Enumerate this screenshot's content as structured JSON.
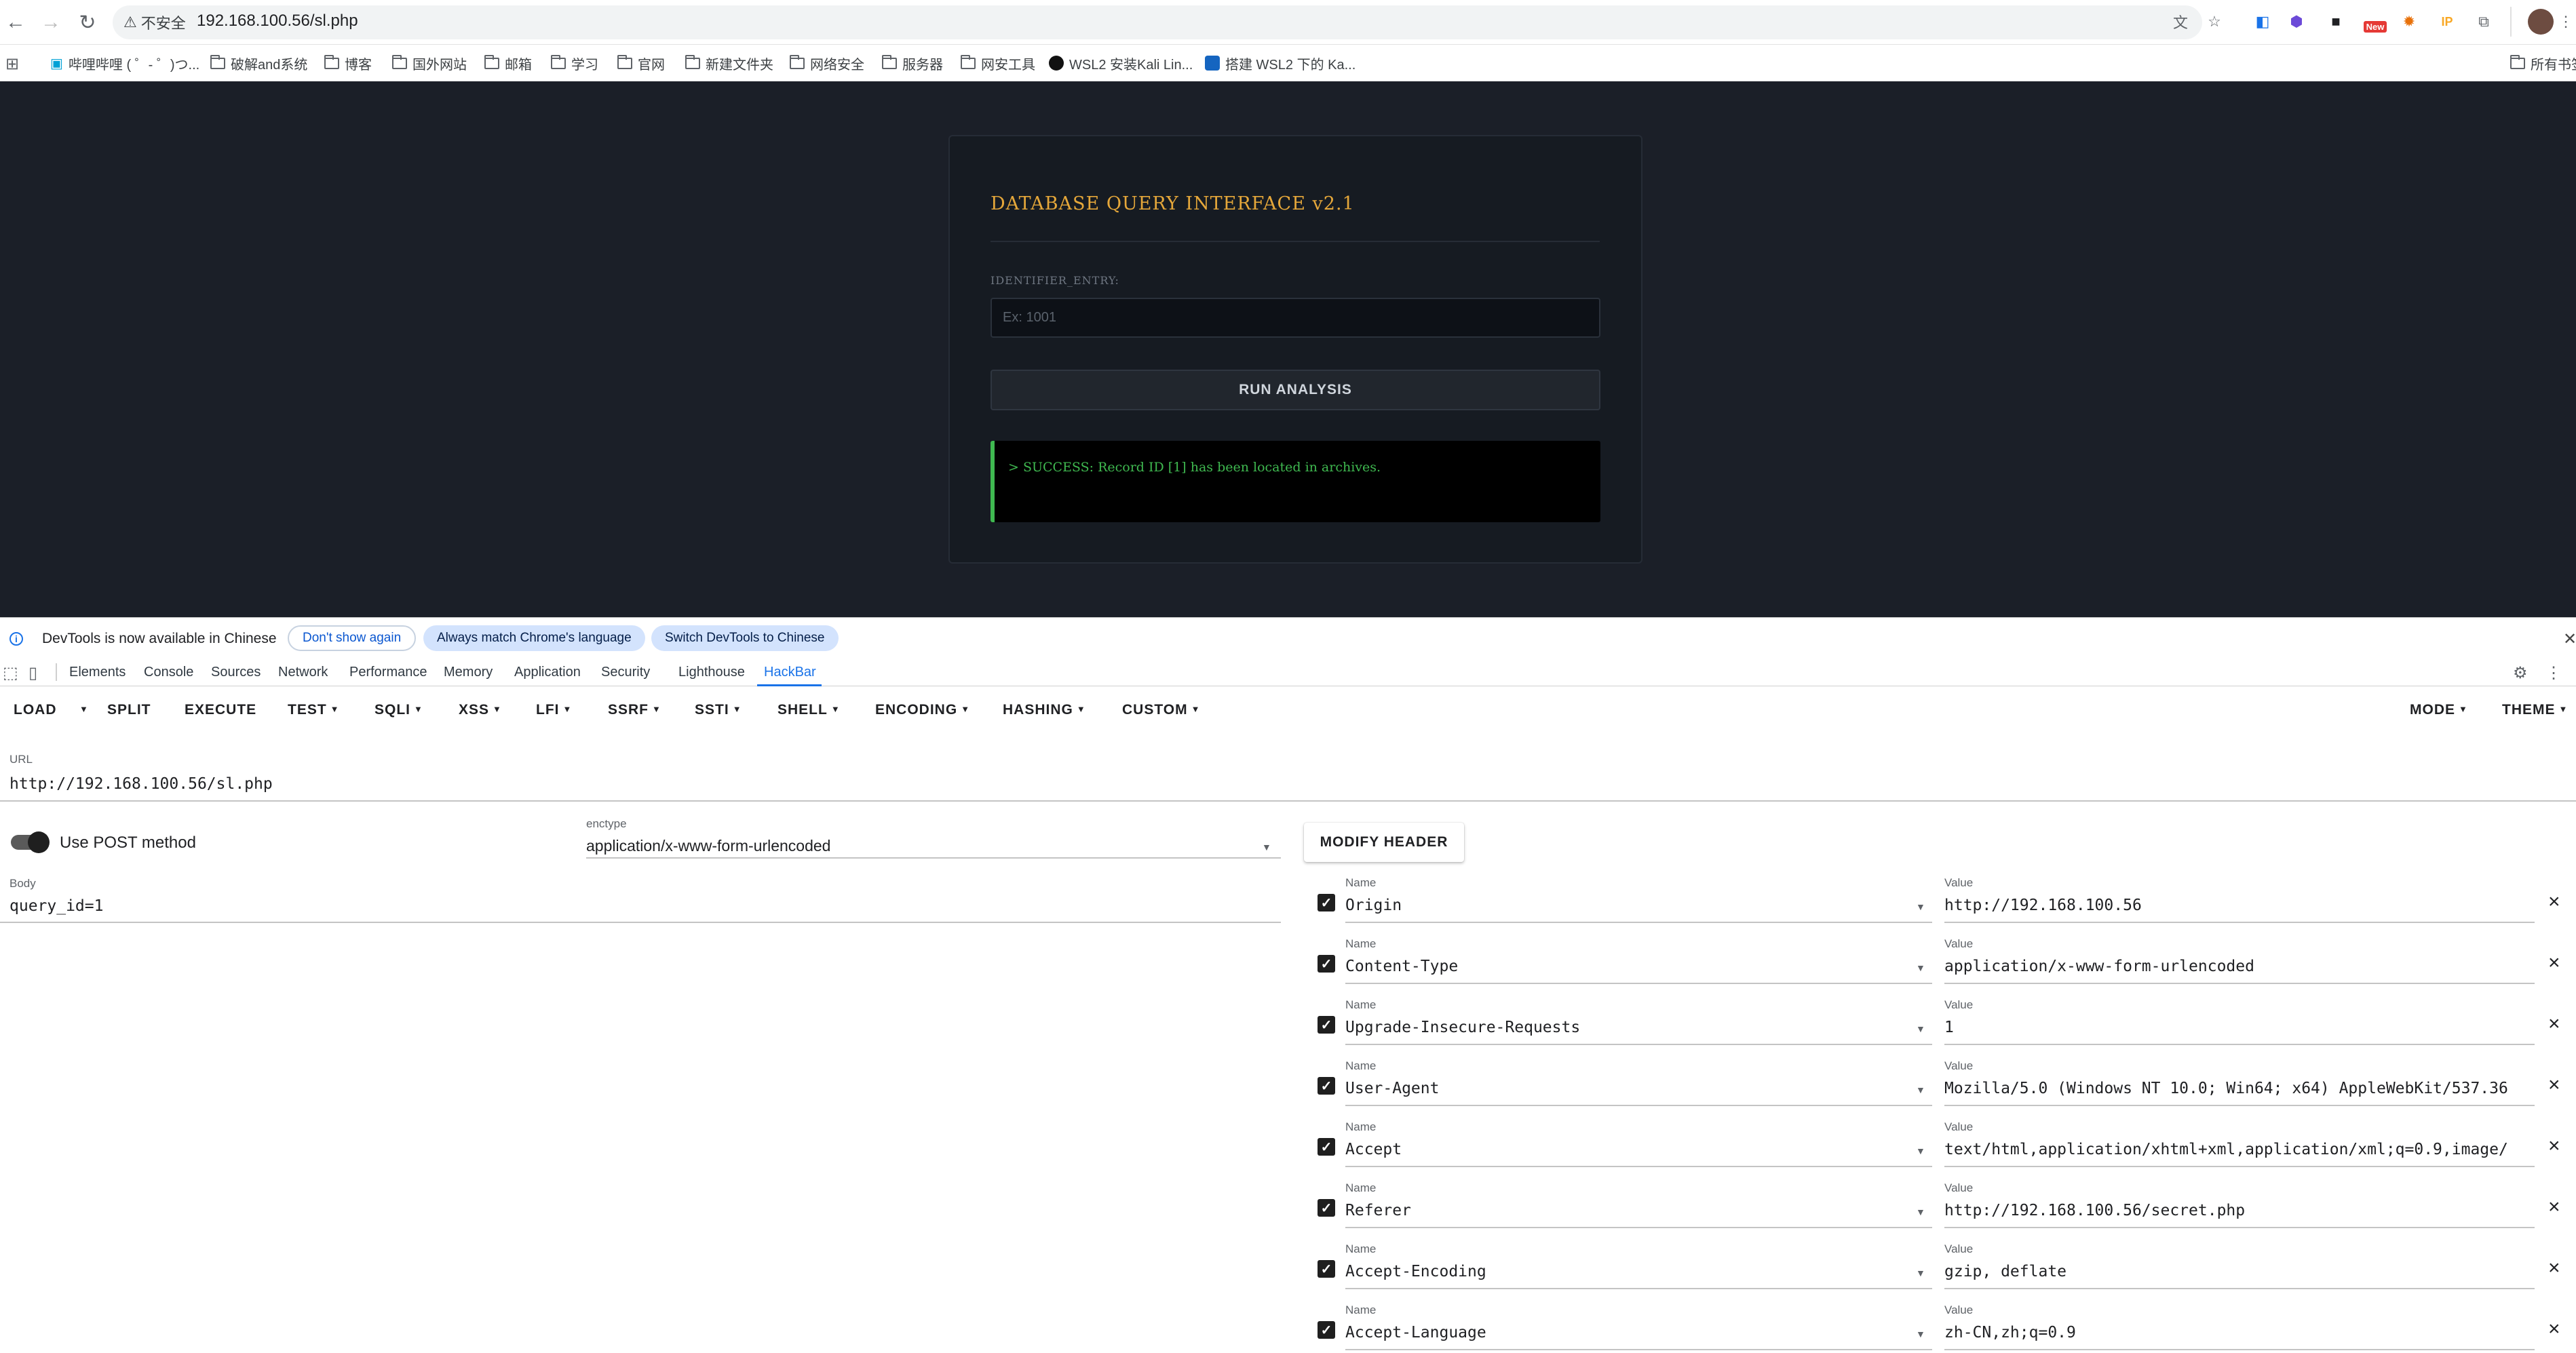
{
  "browser": {
    "security_label": "不安全",
    "url": "192.168.100.56/sl.php",
    "new_badge": "New",
    "ip_badge": "IP"
  },
  "bookmarks": {
    "items": [
      {
        "label": "哔哩哔哩 ( ゜- ゜)つ...",
        "icon": "bilibili-icon"
      },
      {
        "label": "破解and系统",
        "icon": "folder-icon"
      },
      {
        "label": "博客",
        "icon": "folder-icon"
      },
      {
        "label": "国外网站",
        "icon": "folder-icon"
      },
      {
        "label": "邮箱",
        "icon": "folder-icon"
      },
      {
        "label": "学习",
        "icon": "folder-icon"
      },
      {
        "label": "官网",
        "icon": "folder-icon"
      },
      {
        "label": "新建文件夹",
        "icon": "folder-icon"
      },
      {
        "label": "网络安全",
        "icon": "folder-icon"
      },
      {
        "label": "服务器",
        "icon": "folder-icon"
      },
      {
        "label": "网安工具",
        "icon": "folder-icon"
      },
      {
        "label": "WSL2 安装Kali Lin...",
        "icon": "github-icon"
      },
      {
        "label": "搭建 WSL2 下的 Ka...",
        "icon": "site-icon"
      }
    ],
    "all_bookmarks": "所有书签"
  },
  "page": {
    "title": "DATABASE QUERY INTERFACE v2.1",
    "identifier_label": "IDENTIFIER_ENTRY:",
    "identifier_placeholder": "Ex: 1001",
    "run_button": "RUN ANALYSIS",
    "result": "> SUCCESS: Record ID [1] has been located in archives."
  },
  "devtools": {
    "info_text": "DevTools is now available in Chinese",
    "dont_show": "Don't show again",
    "always_match": "Always match Chrome's language",
    "switch_chinese": "Switch DevTools to Chinese",
    "tabs": [
      "Elements",
      "Console",
      "Sources",
      "Network",
      "Performance",
      "Memory",
      "Application",
      "Security",
      "Lighthouse",
      "HackBar"
    ],
    "active_tab": "HackBar"
  },
  "hackbar": {
    "menu": [
      "LOAD",
      "SPLIT",
      "EXECUTE",
      "TEST",
      "SQLI",
      "XSS",
      "LFI",
      "SSRF",
      "SSTI",
      "SHELL",
      "ENCODING",
      "HASHING",
      "CUSTOM"
    ],
    "mode": "MODE",
    "theme": "THEME",
    "url_label": "URL",
    "url_value": "http://192.168.100.56/sl.php",
    "post_method_label": "Use POST method",
    "post_method_enabled": true,
    "enctype_label": "enctype",
    "enctype_value": "application/x-www-form-urlencoded",
    "body_label": "Body",
    "body_value": "query_id=1",
    "modify_header": "MODIFY HEADER",
    "name_label": "Name",
    "value_label": "Value",
    "headers": [
      {
        "name": "Origin",
        "value": "http://192.168.100.56",
        "checked": true
      },
      {
        "name": "Content-Type",
        "value": "application/x-www-form-urlencoded",
        "checked": true
      },
      {
        "name": "Upgrade-Insecure-Requests",
        "value": "1",
        "checked": true
      },
      {
        "name": "User-Agent",
        "value": "Mozilla/5.0 (Windows NT 10.0; Win64; x64) AppleWebKit/537.36",
        "checked": true
      },
      {
        "name": "Accept",
        "value": "text/html,application/xhtml+xml,application/xml;q=0.9,image/",
        "checked": true
      },
      {
        "name": "Referer",
        "value": "http://192.168.100.56/secret.php",
        "checked": true
      },
      {
        "name": "Accept-Encoding",
        "value": "gzip, deflate",
        "checked": true
      },
      {
        "name": "Accept-Language",
        "value": "zh-CN,zh;q=0.9",
        "checked": true
      }
    ]
  },
  "colors": {
    "page_bg": "#1b1f28",
    "title_accent": "#e5a73a",
    "success": "#3fb950",
    "devtools_accent": "#1a73e8"
  }
}
